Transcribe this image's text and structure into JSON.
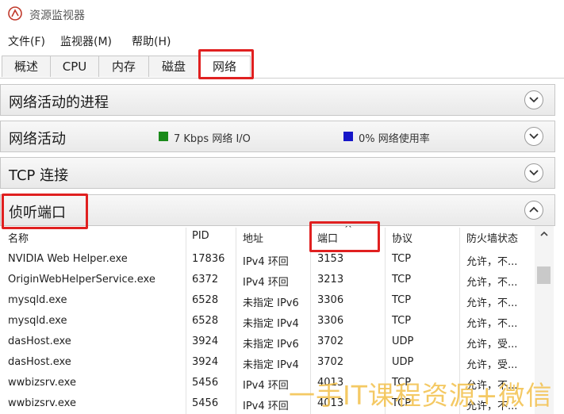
{
  "window": {
    "title": "资源监视器"
  },
  "menu": [
    "文件(F)",
    "监视器(M)",
    "帮助(H)"
  ],
  "tabs": [
    {
      "label": "概述"
    },
    {
      "label": "CPU"
    },
    {
      "label": "内存"
    },
    {
      "label": "磁盘"
    },
    {
      "label": "网络",
      "active": true
    }
  ],
  "sections": {
    "network_processes": {
      "title": "网络活动的进程"
    },
    "network_activity": {
      "title": "网络活动",
      "io_legend": "7 Kbps 网络 I/O",
      "io_color": "#1a8a1a",
      "usage_legend": "0% 网络使用率",
      "usage_color": "#1616c8"
    },
    "tcp": {
      "title": "TCP 连接"
    },
    "listening_ports": {
      "title": "侦听端口"
    }
  },
  "ports_table": {
    "columns": [
      "名称",
      "PID",
      "地址",
      "端口",
      "协议",
      "防火墙状态"
    ],
    "sort_indicator": "^",
    "rows": [
      [
        "NVIDIA Web Helper.exe",
        "17836",
        "IPv4 环回",
        "3153",
        "TCP",
        "允许，不..."
      ],
      [
        "OriginWebHelperService.exe",
        "6372",
        "IPv4 环回",
        "3213",
        "TCP",
        "允许，不..."
      ],
      [
        "mysqld.exe",
        "6528",
        "未指定 IPv6",
        "3306",
        "TCP",
        "允许，不..."
      ],
      [
        "mysqld.exe",
        "6528",
        "未指定 IPv4",
        "3306",
        "TCP",
        "允许，不..."
      ],
      [
        "dasHost.exe",
        "3924",
        "未指定 IPv6",
        "3702",
        "UDP",
        "允许，受..."
      ],
      [
        "dasHost.exe",
        "3924",
        "未指定 IPv4",
        "3702",
        "UDP",
        "允许，受..."
      ],
      [
        "wwbizsrv.exe",
        "5456",
        "IPv4 环回",
        "4013",
        "TCP",
        "允许，不..."
      ],
      [
        "wwbizsrv.exe",
        "5456",
        "IPv4 环回",
        "4013",
        "TCP",
        "允许，不..."
      ]
    ]
  },
  "watermark": "一手IT课程资源+微信"
}
